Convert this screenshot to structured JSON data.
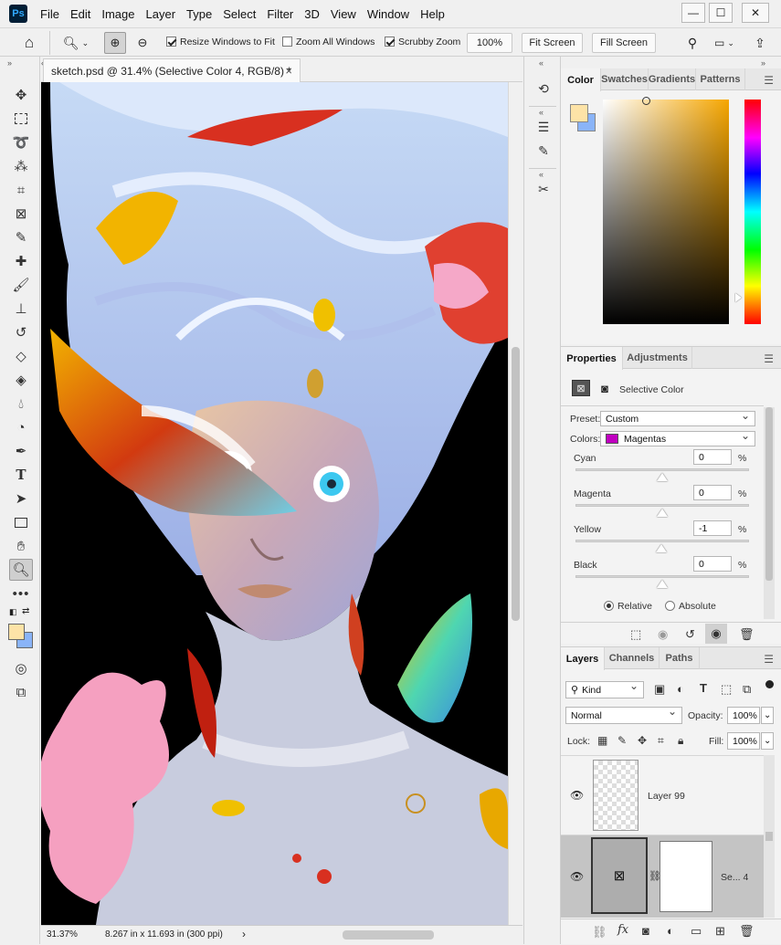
{
  "app": {
    "logo": "Ps"
  },
  "menu": [
    "File",
    "Edit",
    "Image",
    "Layer",
    "Type",
    "Select",
    "Filter",
    "3D",
    "View",
    "Window",
    "Help"
  ],
  "window_controls": {
    "minimize": "—",
    "maximize": "☐",
    "close": "✕"
  },
  "options_bar": {
    "resize_windows": {
      "label": "Resize Windows to Fit",
      "checked": true
    },
    "zoom_all": {
      "label": "Zoom All Windows",
      "checked": false
    },
    "scrubby": {
      "label": "Scrubby Zoom",
      "checked": true
    },
    "zoom_value": "100%",
    "fit_screen": "Fit Screen",
    "fill_screen": "Fill Screen"
  },
  "document": {
    "tab_title": "sketch.psd @ 31.4% (Selective Color 4, RGB/8) *",
    "close": "×"
  },
  "status": {
    "zoom": "31.37%",
    "doc_size": "8.267 in x 11.693 in (300 ppi)",
    "arrow": "›"
  },
  "color_panel": {
    "tabs": [
      "Color",
      "Swatches",
      "Gradients",
      "Patterns"
    ],
    "active": "Color",
    "foreground": "#fde3a7",
    "background": "#8ab4f8",
    "hue_base": "#f6a600"
  },
  "properties_panel": {
    "tabs": [
      "Properties",
      "Adjustments"
    ],
    "title": "Selective Color",
    "preset_label": "Preset:",
    "preset_value": "Custom",
    "colors_label": "Colors:",
    "colors_value": "Magentas",
    "colors_swatch": "#c000c0",
    "sliders": [
      {
        "name": "Cyan",
        "value": "0",
        "unit": "%",
        "position": 0.5
      },
      {
        "name": "Magenta",
        "value": "0",
        "unit": "%",
        "position": 0.5
      },
      {
        "name": "Yellow",
        "value": "-1",
        "unit": "%",
        "position": 0.495
      },
      {
        "name": "Black",
        "value": "0",
        "unit": "%",
        "position": 0.5
      }
    ],
    "method_relative": "Relative",
    "method_absolute": "Absolute",
    "method_selected": "Relative"
  },
  "layers_panel": {
    "tabs": [
      "Layers",
      "Channels",
      "Paths"
    ],
    "kind_label": "Kind",
    "blend_mode": "Normal",
    "opacity_label": "Opacity:",
    "opacity_value": "100%",
    "lock_label": "Lock:",
    "fill_label": "Fill:",
    "fill_value": "100%",
    "layers": [
      {
        "name": "Layer 99",
        "visible": true,
        "selected": false
      },
      {
        "name": "Se... 4",
        "visible": true,
        "selected": true
      }
    ]
  }
}
